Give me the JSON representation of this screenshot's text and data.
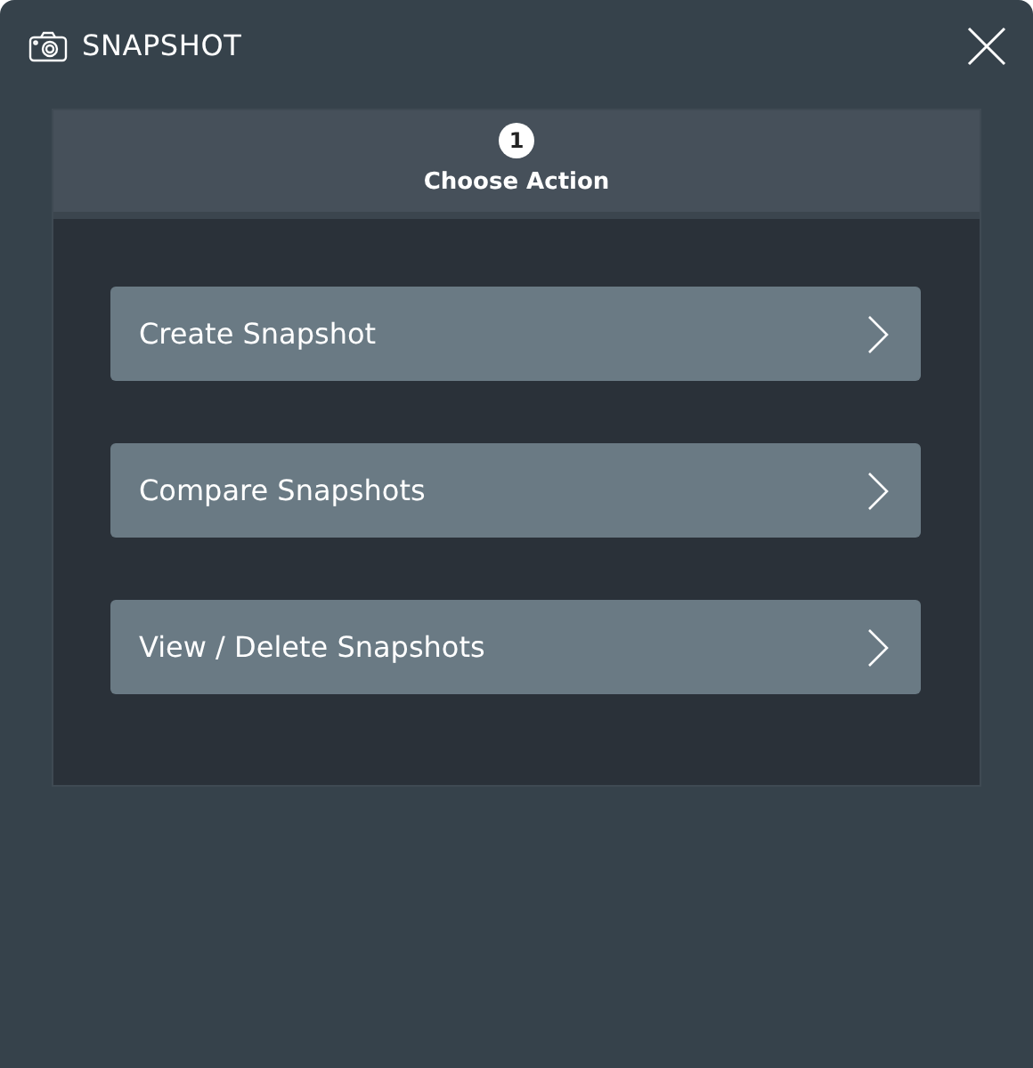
{
  "window": {
    "title": "SNAPSHOT"
  },
  "step": {
    "number": "1",
    "label": "Choose Action"
  },
  "actions": [
    {
      "label": "Create Snapshot"
    },
    {
      "label": "Compare Snapshots"
    },
    {
      "label": "View / Delete Snapshots"
    }
  ]
}
